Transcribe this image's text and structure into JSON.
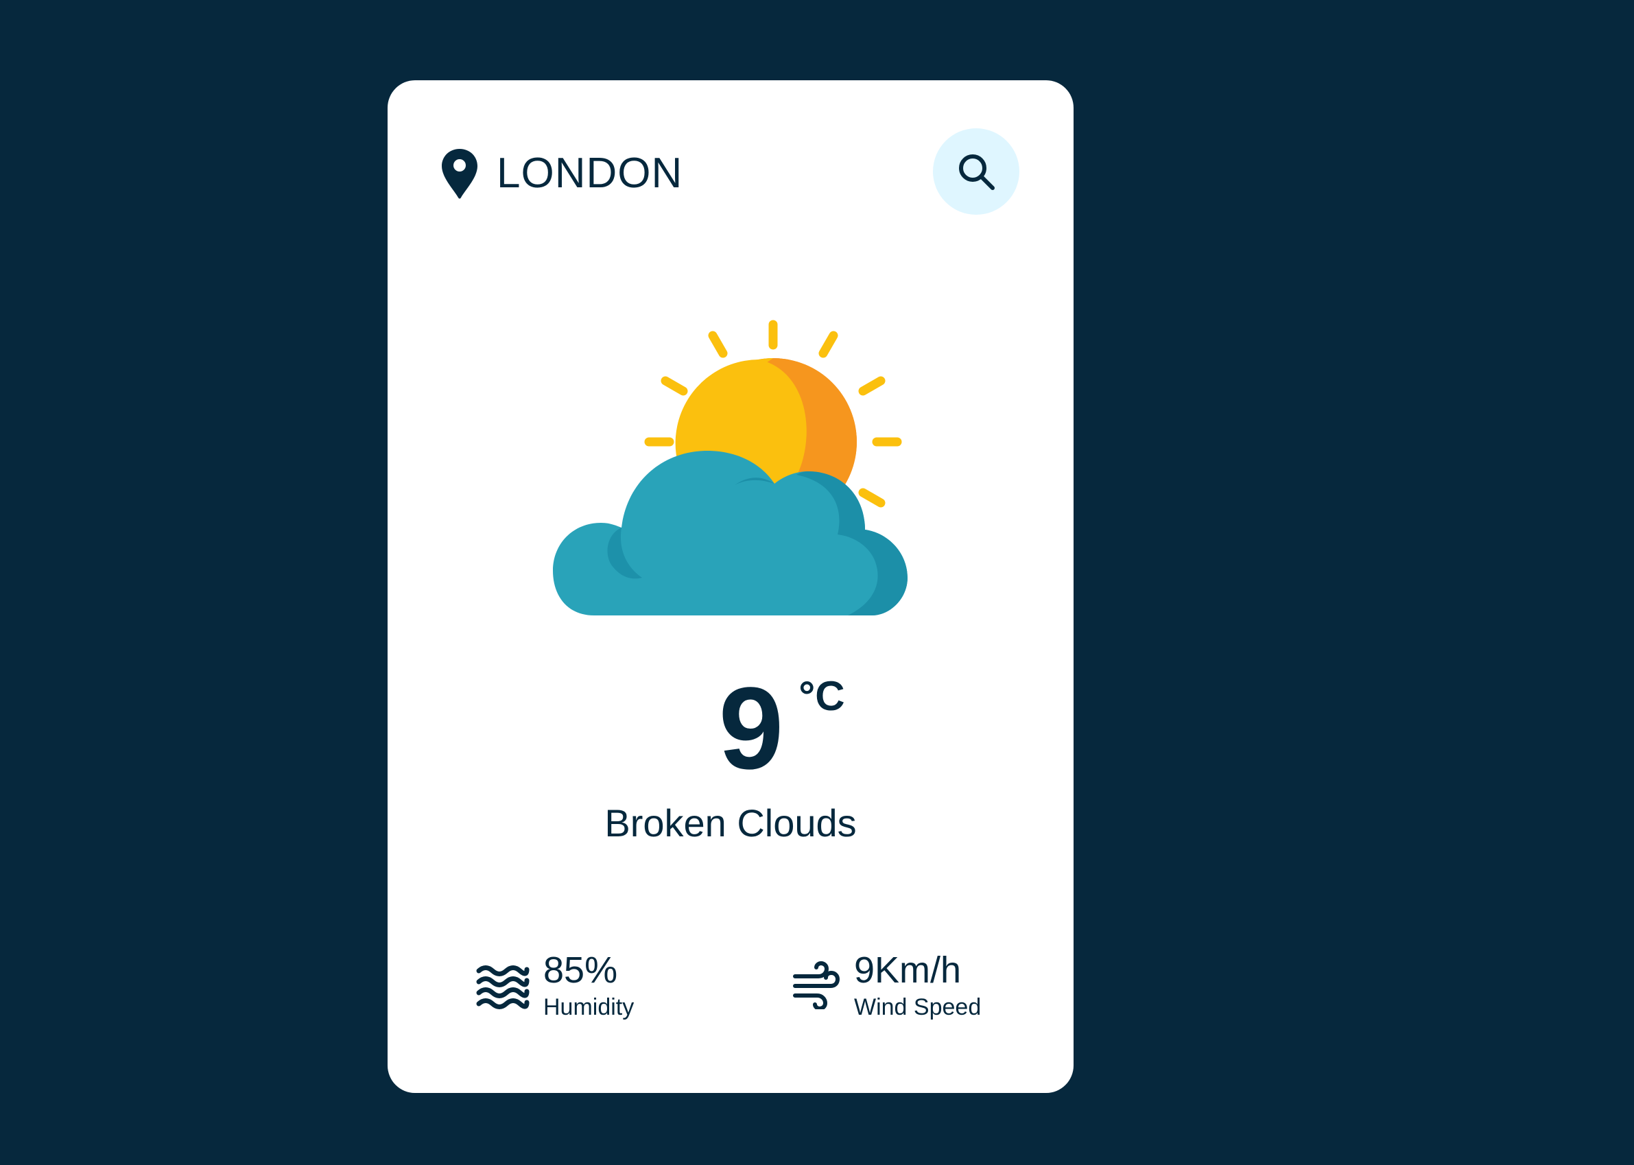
{
  "location": {
    "city": "LONDON",
    "icon": "map-pin-icon"
  },
  "search": {
    "icon": "search-icon"
  },
  "weather": {
    "icon": "partly-cloudy-icon",
    "temperature": "9",
    "unit": "°C",
    "description": "Broken Clouds"
  },
  "details": {
    "humidity": {
      "value": "85%",
      "label": "Humidity",
      "icon": "waves-icon"
    },
    "wind": {
      "value": "9Km/h",
      "label": "Wind Speed",
      "icon": "wind-icon"
    }
  },
  "colors": {
    "background": "#06283D",
    "card": "#FFFFFF",
    "text": "#06283D",
    "search_button_bg": "#DFF6FF",
    "sun": "#FBC00E",
    "sun_shade": "#F6961E",
    "cloud": "#29A3B9",
    "cloud_shade": "#1C8FA8"
  }
}
